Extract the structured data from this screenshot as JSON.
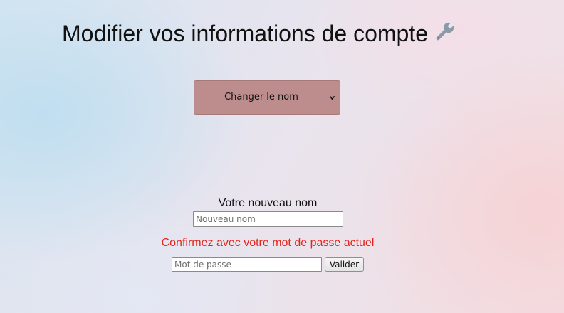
{
  "page": {
    "title": "Modifier vos informations de compte",
    "title_icon": "wrench-icon"
  },
  "action_select": {
    "selected": "Changer le nom",
    "icon": "chevron-down-icon"
  },
  "form": {
    "name_label": "Votre nouveau nom",
    "name_placeholder": "Nouveau nom",
    "confirm_label": "Confirmez avec votre mot de passe actuel",
    "password_placeholder": "Mot de passe",
    "submit_label": "Valider"
  },
  "colors": {
    "select_background": "#bd8c8c",
    "confirm_text": "#e2241c",
    "wrench": "#8a9aa6"
  }
}
